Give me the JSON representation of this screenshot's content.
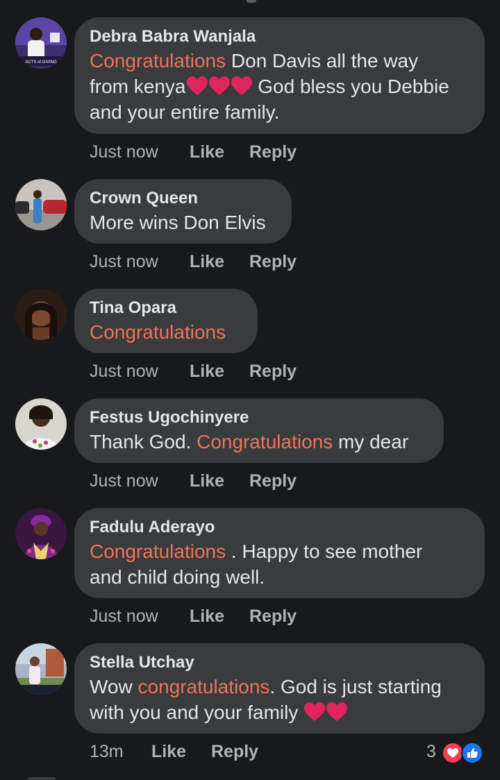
{
  "comments": [
    {
      "author": "Debra Babra Wanjala",
      "highlight": "Congratulations",
      "text_a": " Don Davis all the way",
      "text_b": "from kenya",
      "text_c": " God bless you Debbie",
      "text_d": "and your entire family.",
      "avatar_icon": "profile-photo-preacher",
      "avatar_caption": "ACTS of GIVING",
      "time": "Just now",
      "like": "Like",
      "reply": "Reply"
    },
    {
      "author": "Crown Queen",
      "text": "More wins Don Elvis",
      "avatar_icon": "profile-photo-woman-car",
      "time": "Just now",
      "like": "Like",
      "reply": "Reply"
    },
    {
      "author": "Tina Opara",
      "highlight": "Congratulations",
      "avatar_icon": "profile-photo-woman",
      "time": "Just now",
      "like": "Like",
      "reply": "Reply"
    },
    {
      "author": "Festus Ugochinyere",
      "text_a": "Thank God. ",
      "highlight": "Congratulations",
      "text_b": " my dear",
      "avatar_icon": "profile-photo-woman-smiling",
      "time": "Just now",
      "like": "Like",
      "reply": "Reply"
    },
    {
      "author": "Fadulu Aderayo",
      "highlight": "Congratulations",
      "text_a": " . Happy to see mother",
      "text_b": "and child doing well.",
      "avatar_icon": "profile-photo-woman-headwrap",
      "time": "Just now",
      "like": "Like",
      "reply": "Reply"
    },
    {
      "author": "Stella Utchay",
      "text_a": "Wow ",
      "highlight": "congratulations",
      "text_b": ". God is just starting",
      "text_c": "with you and your family ",
      "avatar_icon": "profile-photo-woman-outdoor",
      "time": "13m",
      "like": "Like",
      "reply": "Reply",
      "reaction_count": "3",
      "reaction_icons": [
        "love-reaction-icon",
        "like-reaction-icon"
      ]
    }
  ],
  "colors": {
    "background": "#18191a",
    "bubble": "#3a3b3c",
    "highlight": "#f0735a",
    "muted": "#b0b3b8",
    "heart": "#e0245e",
    "love": "#f33e58",
    "like": "#1877f2"
  }
}
